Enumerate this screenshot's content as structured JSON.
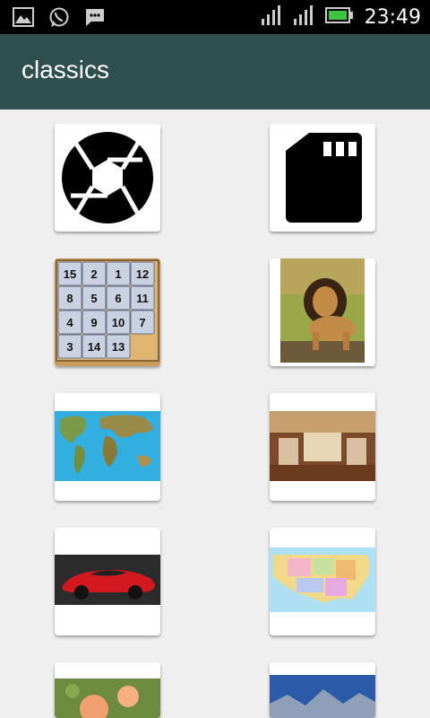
{
  "status_bar": {
    "time": "23:49",
    "icons": [
      "gallery-icon",
      "whatsapp-icon",
      "message-icon",
      "signal-icon",
      "signal-icon",
      "battery-icon"
    ]
  },
  "app_bar": {
    "title": "classics"
  },
  "puzzle_numbers": [
    "15",
    "2",
    "1",
    "12",
    "8",
    "5",
    "6",
    "11",
    "4",
    "9",
    "10",
    "7",
    "3",
    "14",
    "13",
    ""
  ],
  "colors": {
    "app_bar": "#2f4f4f",
    "background": "#efefef",
    "battery": "#3ec43e"
  },
  "tiles": [
    {
      "name": "camera-aperture-tile"
    },
    {
      "name": "sd-card-tile"
    },
    {
      "name": "sliding-puzzle-tile"
    },
    {
      "name": "lion-tile"
    },
    {
      "name": "world-map-tile"
    },
    {
      "name": "interior-room-tile"
    },
    {
      "name": "red-sports-car-tile"
    },
    {
      "name": "usa-map-tile"
    },
    {
      "name": "roses-tile"
    },
    {
      "name": "mountain-landscape-tile"
    }
  ]
}
